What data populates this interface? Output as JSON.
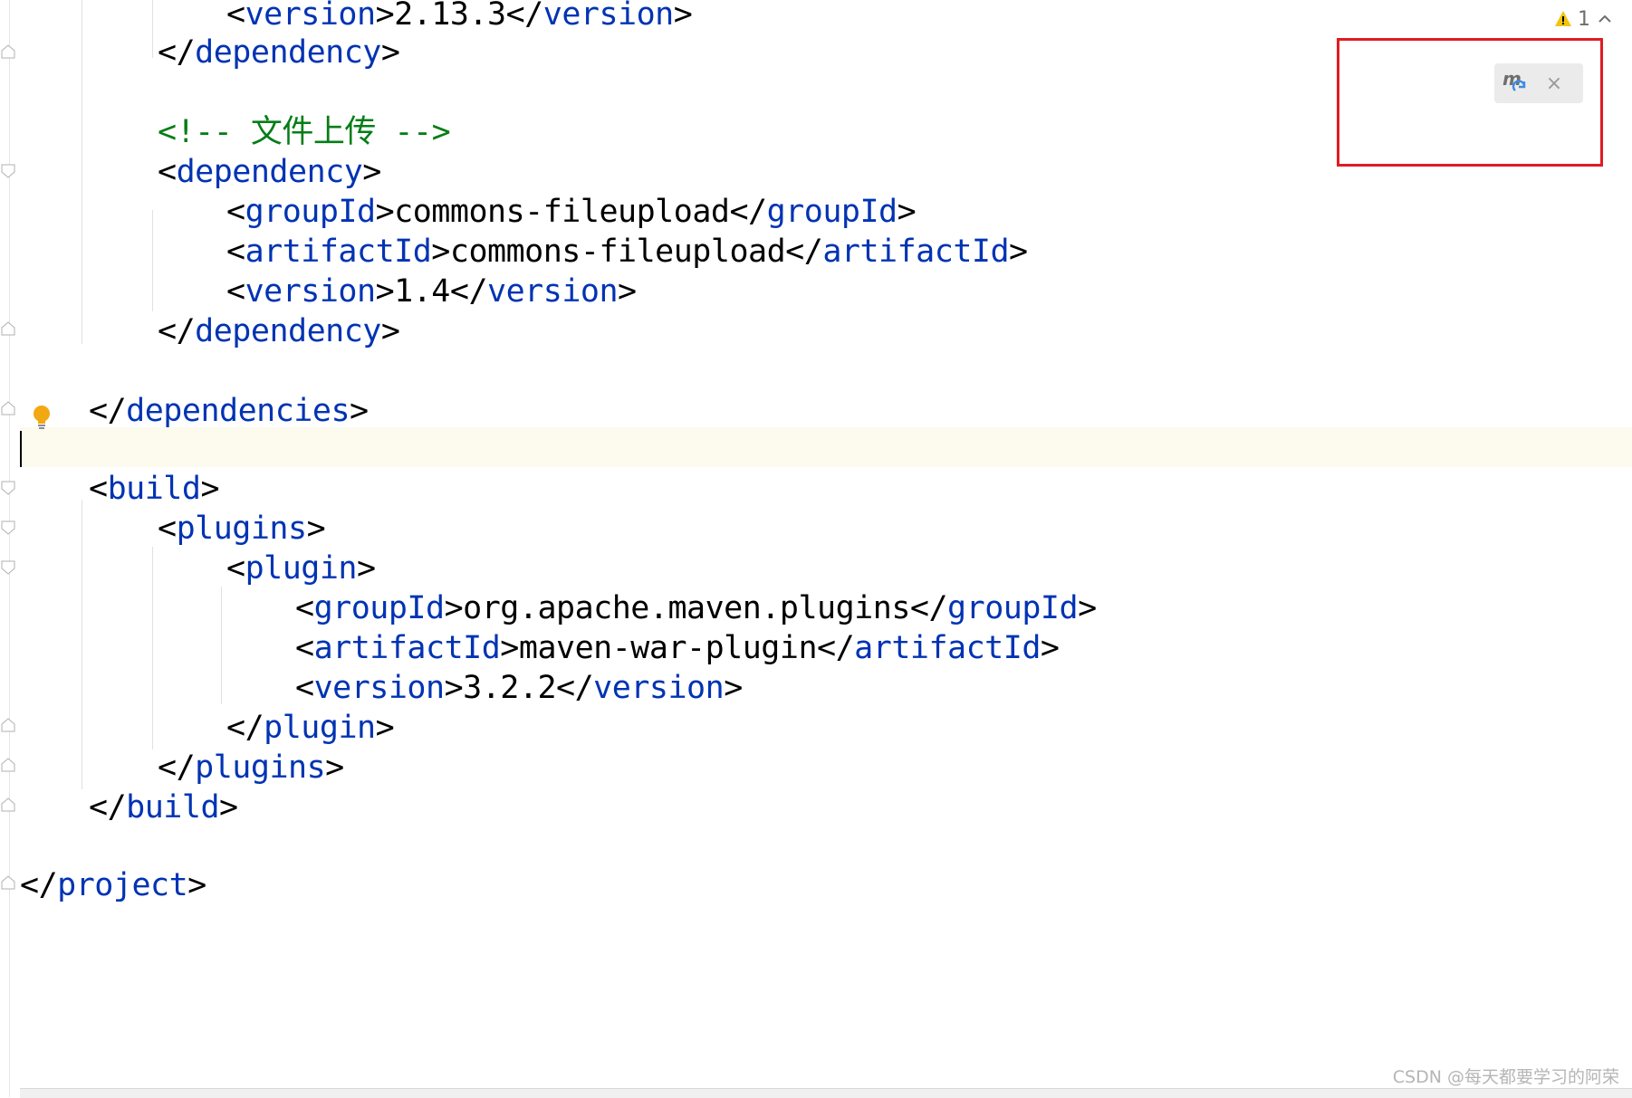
{
  "editor": {
    "lines": [
      {
        "parts": [
          {
            "t": "<",
            "c": "p"
          },
          {
            "t": "version",
            "c": "tag"
          },
          {
            "t": ">2.13.3</",
            "c": "p"
          },
          {
            "t": "version",
            "c": "tag"
          },
          {
            "t": ">",
            "c": "p"
          }
        ]
      },
      {
        "parts": [
          {
            "t": "</",
            "c": "p"
          },
          {
            "t": "dependency",
            "c": "tag"
          },
          {
            "t": ">",
            "c": "p"
          }
        ]
      },
      {
        "parts": [
          {
            "t": "<!-- 文件上传 -->",
            "c": "cmt"
          }
        ]
      },
      {
        "parts": [
          {
            "t": "<",
            "c": "p"
          },
          {
            "t": "dependency",
            "c": "tag"
          },
          {
            "t": ">",
            "c": "p"
          }
        ]
      },
      {
        "parts": [
          {
            "t": "<",
            "c": "p"
          },
          {
            "t": "groupId",
            "c": "tag"
          },
          {
            "t": ">commons-fileupload</",
            "c": "p"
          },
          {
            "t": "groupId",
            "c": "tag"
          },
          {
            "t": ">",
            "c": "p"
          }
        ]
      },
      {
        "parts": [
          {
            "t": "<",
            "c": "p"
          },
          {
            "t": "artifactId",
            "c": "tag"
          },
          {
            "t": ">commons-fileupload</",
            "c": "p"
          },
          {
            "t": "artifactId",
            "c": "tag"
          },
          {
            "t": ">",
            "c": "p"
          }
        ]
      },
      {
        "parts": [
          {
            "t": "<",
            "c": "p"
          },
          {
            "t": "version",
            "c": "tag"
          },
          {
            "t": ">1.4</",
            "c": "p"
          },
          {
            "t": "version",
            "c": "tag"
          },
          {
            "t": ">",
            "c": "p"
          }
        ]
      },
      {
        "parts": [
          {
            "t": "</",
            "c": "p"
          },
          {
            "t": "dependency",
            "c": "tag"
          },
          {
            "t": ">",
            "c": "p"
          }
        ]
      },
      {
        "parts": [
          {
            "t": "</",
            "c": "p"
          },
          {
            "t": "dependencies",
            "c": "tag"
          },
          {
            "t": ">",
            "c": "p"
          }
        ]
      },
      {
        "parts": [
          {
            "t": "<",
            "c": "p"
          },
          {
            "t": "build",
            "c": "tag"
          },
          {
            "t": ">",
            "c": "p"
          }
        ]
      },
      {
        "parts": [
          {
            "t": "<",
            "c": "p"
          },
          {
            "t": "plugins",
            "c": "tag"
          },
          {
            "t": ">",
            "c": "p"
          }
        ]
      },
      {
        "parts": [
          {
            "t": "<",
            "c": "p"
          },
          {
            "t": "plugin",
            "c": "tag"
          },
          {
            "t": ">",
            "c": "p"
          }
        ]
      },
      {
        "parts": [
          {
            "t": "<",
            "c": "p"
          },
          {
            "t": "groupId",
            "c": "tag"
          },
          {
            "t": ">org.apache.maven.plugins</",
            "c": "p"
          },
          {
            "t": "groupId",
            "c": "tag"
          },
          {
            "t": ">",
            "c": "p"
          }
        ]
      },
      {
        "parts": [
          {
            "t": "<",
            "c": "p"
          },
          {
            "t": "artifactId",
            "c": "tag"
          },
          {
            "t": ">maven-war-plugin</",
            "c": "p"
          },
          {
            "t": "artifactId",
            "c": "tag"
          },
          {
            "t": ">",
            "c": "p"
          }
        ]
      },
      {
        "parts": [
          {
            "t": "<",
            "c": "p"
          },
          {
            "t": "version",
            "c": "tag"
          },
          {
            "t": ">3.2.2</",
            "c": "p"
          },
          {
            "t": "version",
            "c": "tag"
          },
          {
            "t": ">",
            "c": "p"
          }
        ]
      },
      {
        "parts": [
          {
            "t": "</",
            "c": "p"
          },
          {
            "t": "plugin",
            "c": "tag"
          },
          {
            "t": ">",
            "c": "p"
          }
        ]
      },
      {
        "parts": [
          {
            "t": "</",
            "c": "p"
          },
          {
            "t": "plugins",
            "c": "tag"
          },
          {
            "t": ">",
            "c": "p"
          }
        ]
      },
      {
        "parts": [
          {
            "t": "</",
            "c": "p"
          },
          {
            "t": "build",
            "c": "tag"
          },
          {
            "t": ">",
            "c": "p"
          }
        ]
      },
      {
        "parts": [
          {
            "t": "</",
            "c": "p"
          },
          {
            "t": "project",
            "c": "tag"
          },
          {
            "t": ">",
            "c": "p"
          }
        ]
      }
    ]
  },
  "inspection": {
    "warning_count": "1",
    "icon": "warning-icon"
  },
  "maven_popup": {
    "reload_icon": "maven-reload-icon",
    "close_label": "×"
  },
  "watermark": "CSDN @每天都要学习的阿荣",
  "colors": {
    "tag": "#0033b3",
    "comment": "#067d17",
    "caret_line": "#fdfaee",
    "highlight_box": "#e01b24"
  }
}
